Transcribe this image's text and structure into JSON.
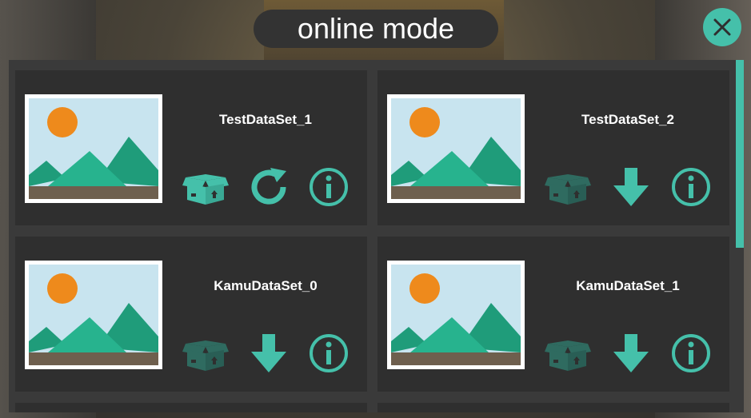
{
  "window": {
    "title": "online mode"
  },
  "close_icon": "close-icon",
  "colors": {
    "accent": "#45c0aa",
    "accent_dim": "#2f6b60",
    "card_bg": "#2f2f2f",
    "panel_bg": "#3a3a3a"
  },
  "datasets": [
    {
      "name": "TestDataSet_1",
      "box_state": "active",
      "action": "refresh-icon",
      "info": "info-icon"
    },
    {
      "name": "TestDataSet_2",
      "box_state": "dim",
      "action": "download-icon",
      "info": "info-icon"
    },
    {
      "name": "KamuDataSet_0",
      "box_state": "dim",
      "action": "download-icon",
      "info": "info-icon"
    },
    {
      "name": "KamuDataSet_1",
      "box_state": "dim",
      "action": "download-icon",
      "info": "info-icon"
    }
  ]
}
